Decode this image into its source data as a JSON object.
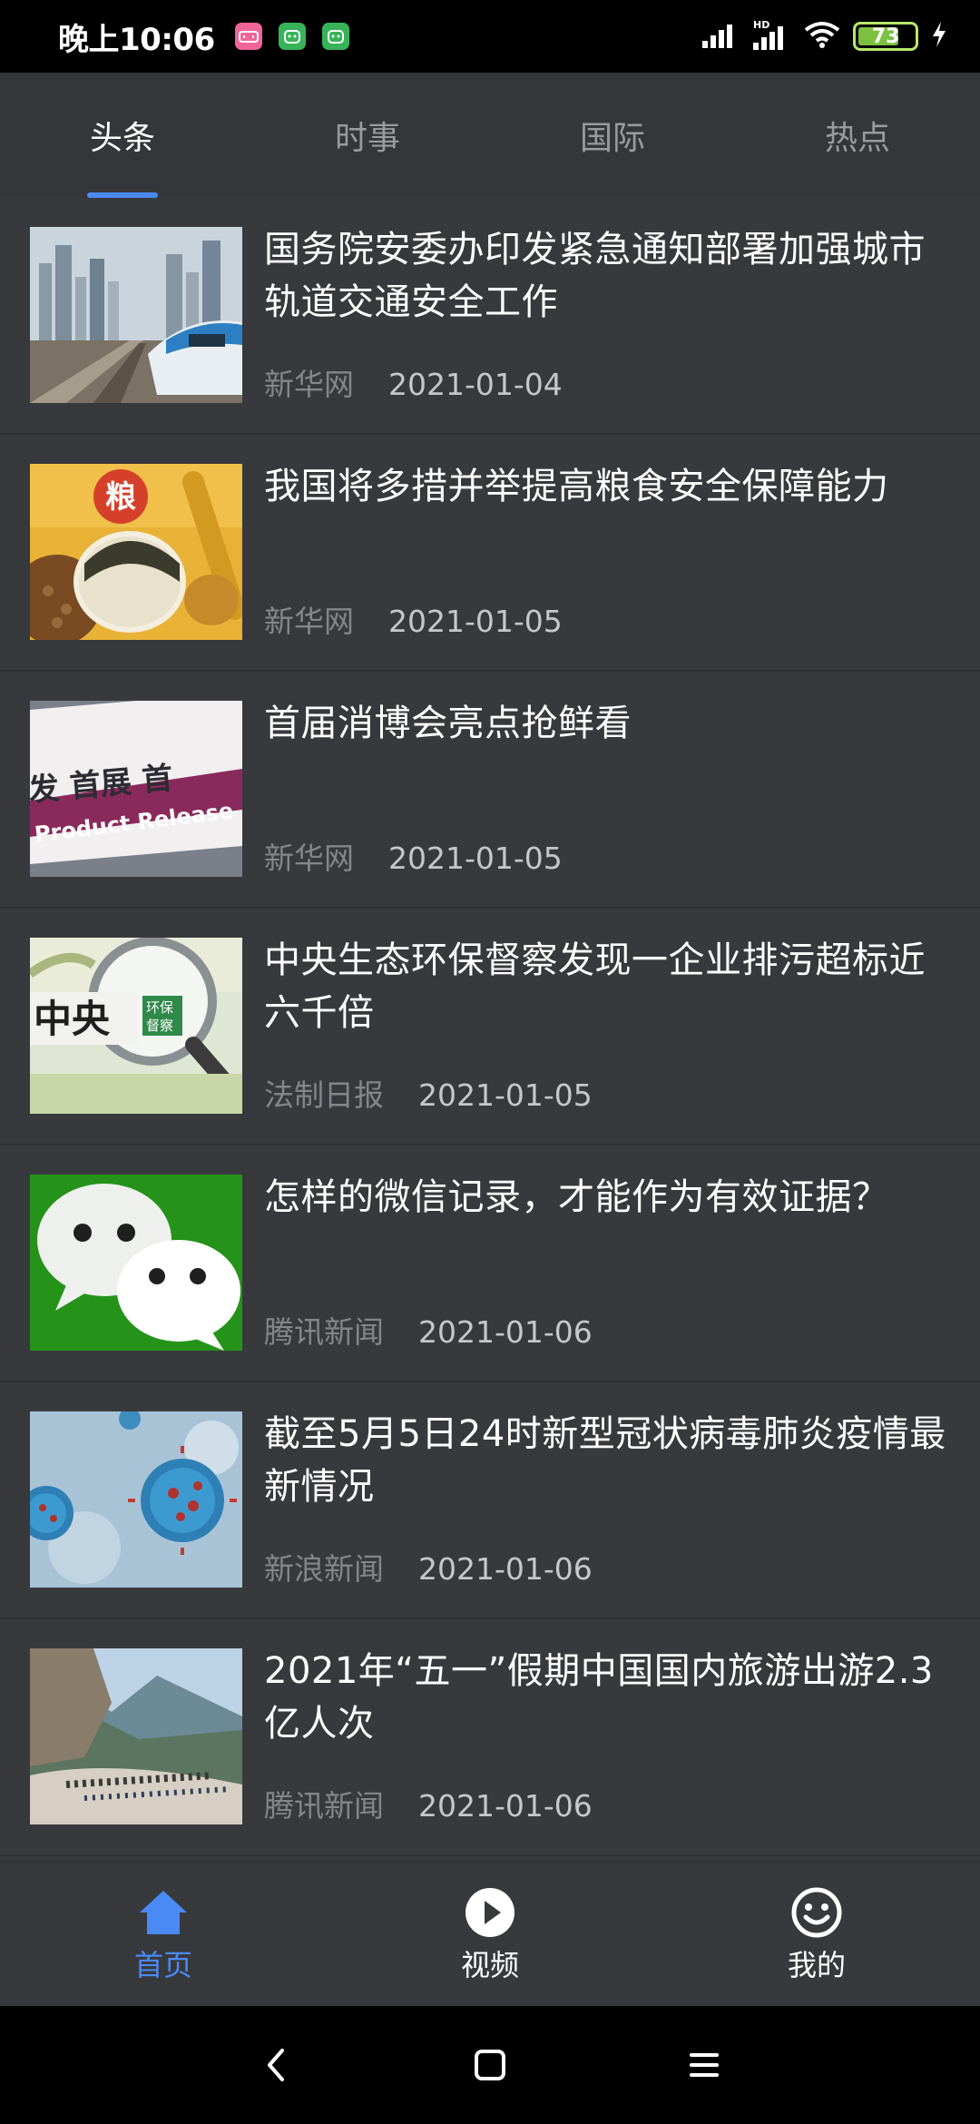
{
  "status_bar": {
    "time": "晚上10:06",
    "battery": "73",
    "battery_level": 0.73,
    "notification_icons": [
      "bilibili-icon",
      "android-icon",
      "android-icon"
    ],
    "network_badge": "HD"
  },
  "tabs": [
    {
      "label": "头条",
      "active": true
    },
    {
      "label": "时事",
      "active": false
    },
    {
      "label": "国际",
      "active": false
    },
    {
      "label": "热点",
      "active": false
    }
  ],
  "news": [
    {
      "title": "国务院安委办印发紧急通知部署加强城市轨道交通安全工作",
      "source": "新华网",
      "date": "2021-01-04",
      "thumb": "train-city-image"
    },
    {
      "title": "我国将多措并举提高粮食安全保障能力",
      "source": "新华网",
      "date": "2021-01-05",
      "thumb": "grain-image",
      "thumb_text": "粮"
    },
    {
      "title": "首届消博会亮点抢鲜看",
      "source": "新华网",
      "date": "2021-01-05",
      "thumb": "product-release-sign-image",
      "thumb_text": "发 首展 首",
      "thumb_text2": "Product Release"
    },
    {
      "title": "中央生态环保督察发现一企业排污超标近六千倍",
      "source": "法制日报",
      "date": "2021-01-05",
      "thumb": "magnifier-image",
      "thumb_text": "中央",
      "thumb_text2": "环保",
      "thumb_text3": "督察"
    },
    {
      "title": "怎样的微信记录，才能作为有效证据？",
      "source": "腾讯新闻",
      "date": "2021-01-06",
      "thumb": "wechat-logo-image"
    },
    {
      "title": "截至5月5日24时新型冠状病毒肺炎疫情最新情况",
      "source": "新浪新闻",
      "date": "2021-01-06",
      "thumb": "virus-image"
    },
    {
      "title": "2021年“五一”假期中国国内旅游出游2.3亿人次",
      "source": "腾讯新闻",
      "date": "2021-01-06",
      "thumb": "mountain-tourists-image"
    }
  ],
  "bottom_nav": [
    {
      "label": "首页",
      "icon": "home-icon",
      "active": true
    },
    {
      "label": "视频",
      "icon": "play-icon",
      "active": false
    },
    {
      "label": "我的",
      "icon": "smile-icon",
      "active": false
    }
  ],
  "colors": {
    "accent": "#4a8af4",
    "background": "#38393c",
    "tab_bar": "#353639"
  }
}
